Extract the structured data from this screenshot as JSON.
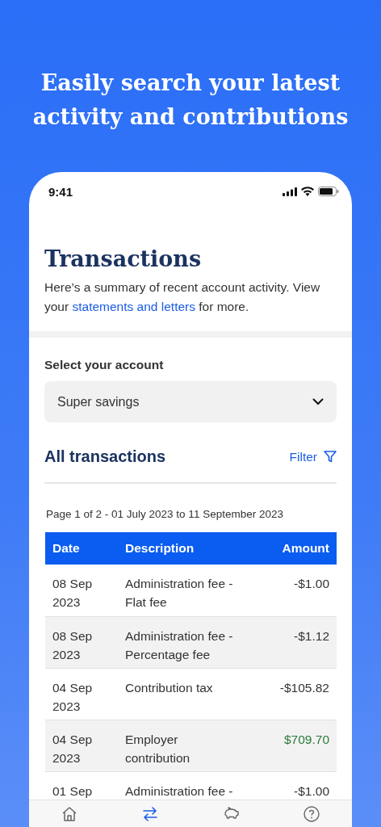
{
  "headline": "Easily search your latest activity and contributions",
  "status_bar": {
    "time": "9:41"
  },
  "page": {
    "title": "Transactions",
    "intro": "Here’s a summary of recent account activity. View your ",
    "link": "statements and letters",
    "intro_end": " for more."
  },
  "account": {
    "label": "Select your account",
    "value": "Super savings"
  },
  "section": {
    "title": "All transactions",
    "filter": "Filter"
  },
  "range": "Page 1 of 2 - 01 July 2023 to 11 September 2023",
  "table": {
    "columns": [
      "Date",
      "Description",
      "Amount"
    ],
    "rows": [
      {
        "date": "08 Sep 2023",
        "description": "Administration fee - Flat fee",
        "amount": "-$1.00",
        "credit": false
      },
      {
        "date": "08 Sep 2023",
        "description": "Administration fee - Percentage fee",
        "amount": "-$1.12",
        "credit": false
      },
      {
        "date": "04 Sep 2023",
        "description": "Contribution tax",
        "amount": "-$105.82",
        "credit": false
      },
      {
        "date": "04 Sep 2023",
        "description": "Employer contribution",
        "amount": "$709.70",
        "credit": true
      },
      {
        "date": "01 Sep",
        "description": "Administration fee -",
        "amount": "-$1.00",
        "credit": false
      }
    ]
  },
  "tab_bar": [
    {
      "kind": "home",
      "selected": false
    },
    {
      "kind": "transfer",
      "selected": true
    },
    {
      "kind": "piggy",
      "selected": false
    },
    {
      "kind": "help",
      "selected": false
    }
  ]
}
